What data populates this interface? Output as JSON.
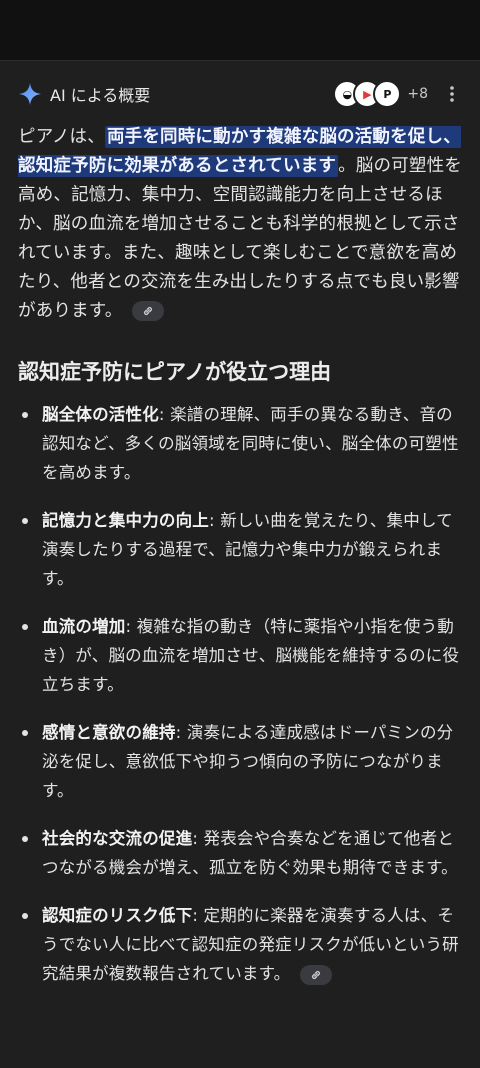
{
  "header": {
    "title": "AI による概要",
    "sources_count": "+8",
    "sources": [
      {
        "icon": "source-favicon-1",
        "bg": "#ffffff",
        "fg": "#111111",
        "glyph": "◒"
      },
      {
        "icon": "source-favicon-youtube",
        "bg": "#ffffff",
        "fg": "#e53935",
        "glyph": "▶"
      },
      {
        "icon": "source-favicon-p",
        "bg": "#ffffff",
        "fg": "#111111",
        "glyph": "P"
      }
    ]
  },
  "summary": {
    "pre": "ピアノは、",
    "highlight": "両手を同時に動かす複雑な脳の活動を促し、認知症予防に効果があるとされています",
    "post": "。脳の可塑性を高め、記憶力、集中力、空間認識能力を向上させるほか、脳の血流を増加させることも科学的根拠として示されています。また、趣味として楽しむことで意欲を高めたり、他者との交流を生み出したりする点でも良い影響があります。"
  },
  "section": {
    "title": "認知症予防にピアノが役立つ理由",
    "items": [
      {
        "term": "脳全体の活性化",
        "text": ": 楽譜の理解、両手の異なる動き、音の認知など、多くの脳領域を同時に使い、脳全体の可塑性を高めます。"
      },
      {
        "term": "記憶力と集中力の向上",
        "text": ": 新しい曲を覚えたり、集中して演奏したりする過程で、記憶力や集中力が鍛えられます。"
      },
      {
        "term": "血流の増加",
        "text": ": 複雑な指の動き（特に薬指や小指を使う動き）が、脳の血流を増加させ、脳機能を維持するのに役立ちます。"
      },
      {
        "term": "感情と意欲の維持",
        "text": ": 演奏による達成感はドーパミンの分泌を促し、意欲低下や抑うつ傾向の予防につながります。"
      },
      {
        "term": "社会的な交流の促進",
        "text": ": 発表会や合奏などを通じて他者とつながる機会が増え、孤立を防ぐ効果も期待できます。"
      },
      {
        "term": "認知症のリスク低下",
        "text": ": 定期的に楽器を演奏する人は、そうでない人に比べて認知症の発症リスクが低いという研究結果が複数報告されています。"
      }
    ]
  },
  "colors": {
    "background": "#1f1f1f",
    "highlight": "#1e3a7b",
    "sparkle_blue": "#4c8df6"
  }
}
